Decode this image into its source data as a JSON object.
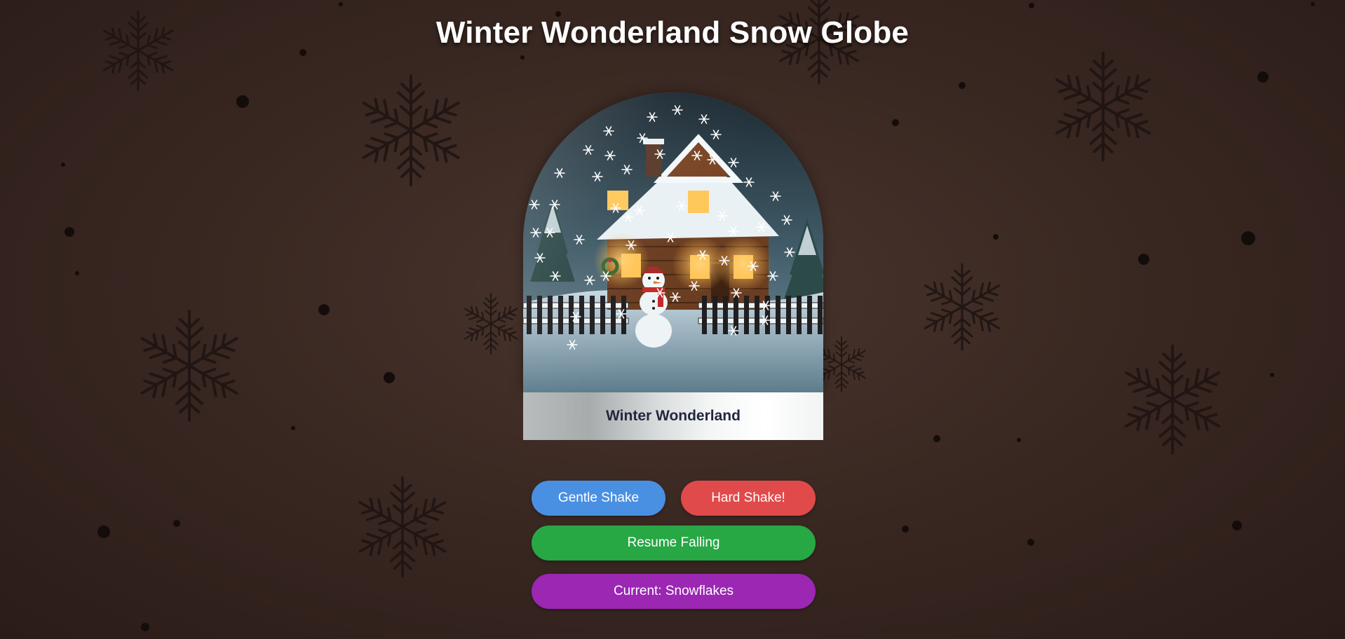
{
  "title": "Winter Wonderland Snow Globe",
  "globe": {
    "label": "Winter Wonderland",
    "scene": [
      "snow-covered-cabin",
      "snowman-icon",
      "picket-fence",
      "pine-trees",
      "falling-snowflakes"
    ]
  },
  "controls": {
    "gentle_shake": "Gentle Shake",
    "hard_shake": "Hard Shake!",
    "resume": "Resume Falling",
    "mode": "Current: Snowflakes"
  },
  "colors": {
    "gentle": "#4a90e2",
    "hard": "#e14a4a",
    "resume": "#28a745",
    "mode": "#9b27b3",
    "background": "#3a2822"
  }
}
